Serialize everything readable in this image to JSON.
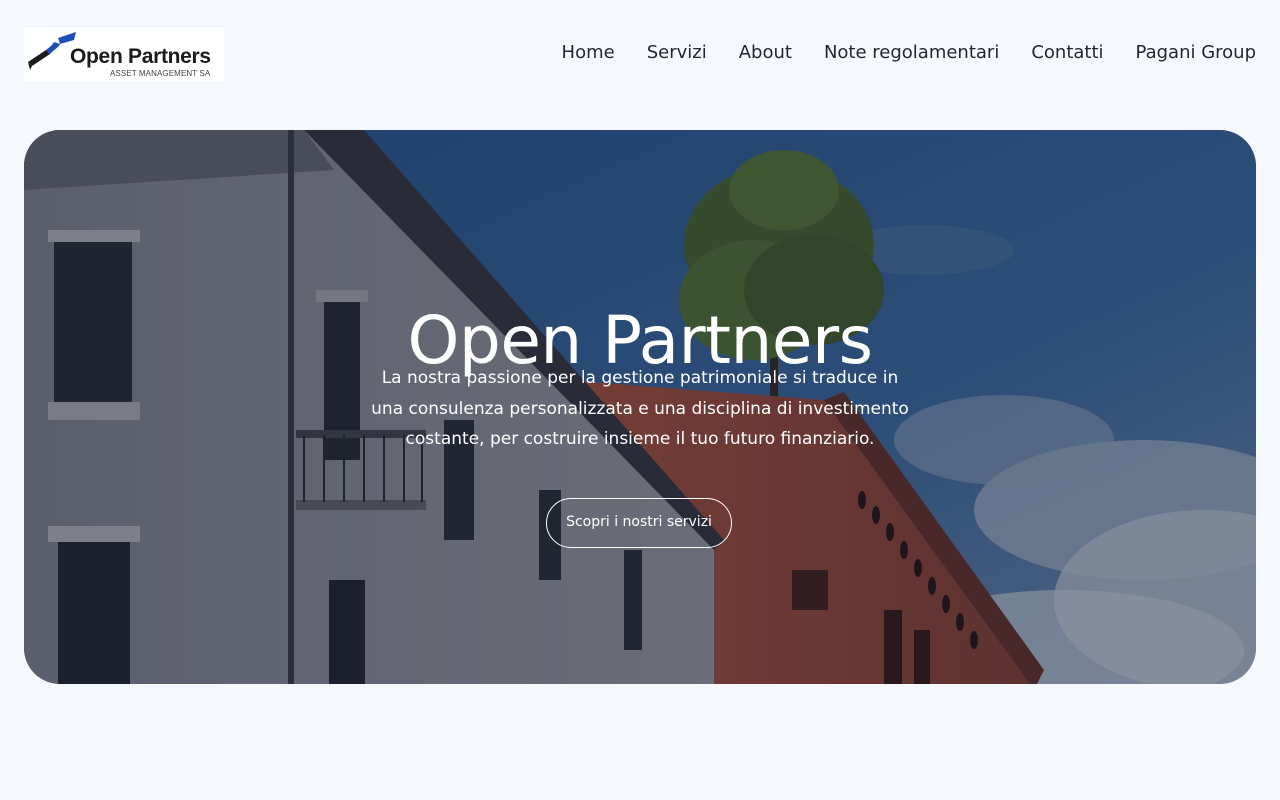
{
  "header": {
    "logo": {
      "name": "Open Partners",
      "subtitle": "ASSET MANAGEMENT SA",
      "icon": "open-partners-mark"
    },
    "nav": [
      "Home",
      "Servizi",
      "About",
      "Note regolamentari",
      "Contatti",
      "Pagani Group"
    ]
  },
  "hero": {
    "title": "Open Partners",
    "description": "La nostra passione per la gestione patrimoniale si traduce in una consulenza personalizzata e una disciplina di investimento costante, per costruire insieme il tuo futuro finanziario.",
    "cta_label": "Scopri i nostri servizi",
    "background": "historic-building-and-brick-tower-with-tree-under-blue-sky"
  },
  "colors": {
    "page_background": "#f5f8fd",
    "nav_text": "#1f2533",
    "logo_accent": "#1f4fb5",
    "hero_text": "#ffffff"
  }
}
